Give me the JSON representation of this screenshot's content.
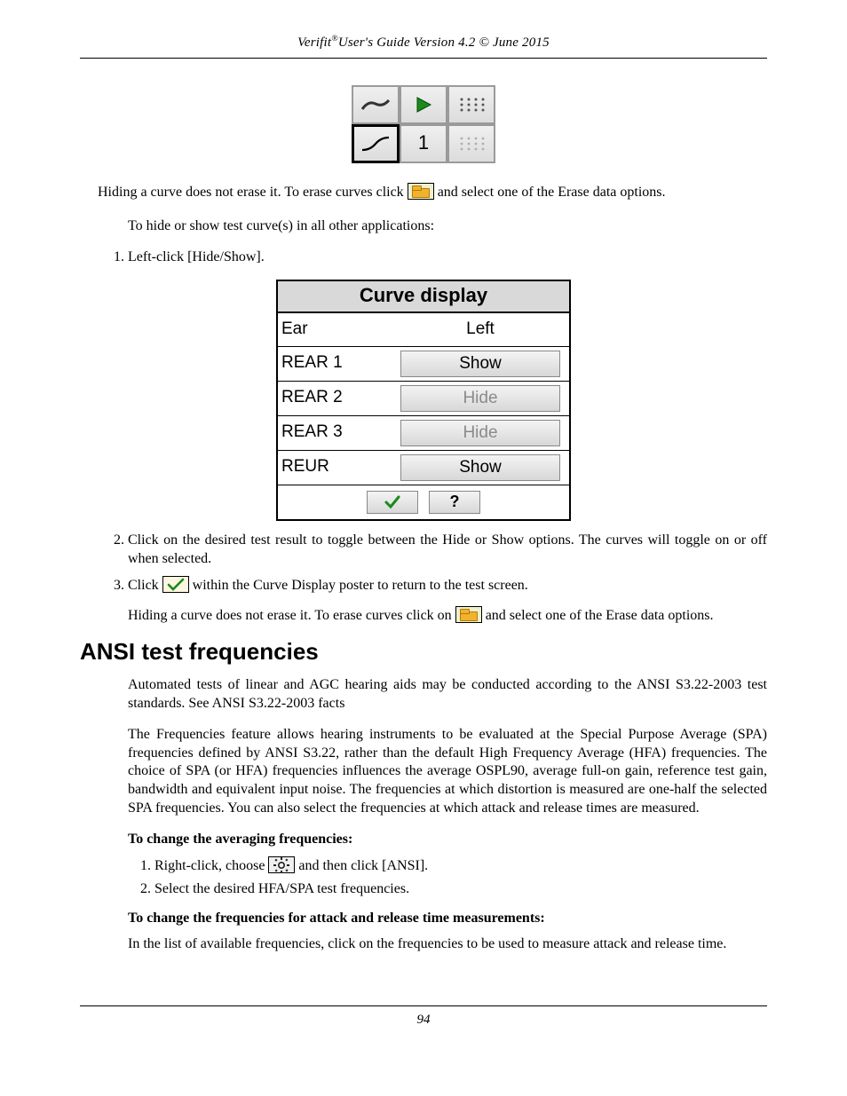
{
  "header": {
    "product": "Verifit",
    "reg": "®",
    "rest": "User's Guide Version 4.2 © June 2015"
  },
  "toolbar": {
    "number": "1"
  },
  "para1a": "Hiding a curve does not erase it. To erase curves click ",
  "para1b": " and select one of the Erase data options.",
  "para2": "To hide or show test curve(s) in all other applications:",
  "step1": "Left-click [Hide/Show].",
  "dlg": {
    "title": "Curve display",
    "rows": [
      {
        "label": "Ear",
        "value": "Left",
        "button": false
      },
      {
        "label": "REAR 1",
        "value": "Show",
        "button": true,
        "dim": false
      },
      {
        "label": "REAR 2",
        "value": "Hide",
        "button": true,
        "dim": true
      },
      {
        "label": "REAR 3",
        "value": "Hide",
        "button": true,
        "dim": true
      },
      {
        "label": "REUR",
        "value": "Show",
        "button": true,
        "dim": false
      }
    ],
    "help": "?"
  },
  "step2": "Click on the desired test result to toggle between the Hide or Show options.  The curves will toggle on or off when selected.",
  "step3a": "Click ",
  "step3b": " within the Curve Display poster to return to the test screen.",
  "step3_follow_a": "Hiding a curve does not erase it. To erase curves click on ",
  "step3_follow_b": " and select one of the Erase data options.",
  "h2": "ANSI test frequencies",
  "ansi_p1": "Automated tests of linear and AGC hearing aids may be conducted according to the ANSI S3.22-2003 test standards. See ANSI S3.22-2003 facts",
  "ansi_p2": "The Frequencies feature allows hearing instruments to be evaluated at the Special Purpose Average (SPA) frequencies defined by ANSI S3.22, rather than the default High Frequency Average (HFA) frequencies. The choice of SPA (or HFA) frequencies influences the average OSPL90, average full-on gain, reference test gain, bandwidth and equivalent input noise. The frequencies at which distortion is measured are one-half the selected SPA frequencies. You can also select the frequencies at which attack and release times are measured.",
  "sub1": "To change the averaging frequencies:",
  "sub1_s1a": "Right-click, choose ",
  "sub1_s1b": " and then click [ANSI].",
  "sub1_s2": "Select the desired HFA/SPA test frequencies.",
  "sub2": "To change the frequencies for attack and release time measurements:",
  "sub2_p": "In the list of available frequencies, click on the frequencies to be used to measure attack and release time.",
  "page_number": "94"
}
